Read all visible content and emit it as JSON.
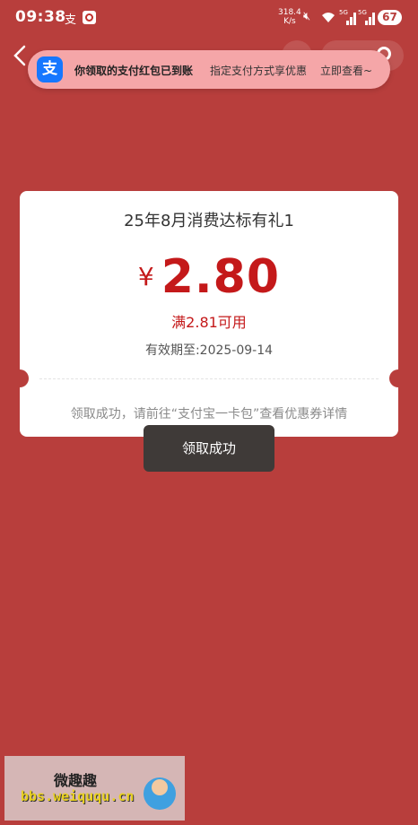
{
  "status_bar": {
    "time": "09:38",
    "net_speed_value": "318.4",
    "net_speed_unit": "K/s",
    "signal1_label": "5G",
    "signal2_label": "5G",
    "battery": "67"
  },
  "notification": {
    "icon_text": "支",
    "title": "你领取的支付红包已到账",
    "subtitle": "指定支付方式享优惠",
    "action": "立即查看~"
  },
  "coupon": {
    "title": "25年8月消费达标有礼1",
    "currency": "¥",
    "amount": "2.80",
    "condition": "满2.81可用",
    "validity": "有效期至:2025-09-14",
    "tip": "领取成功，请前往“支付宝一卡包”查看优惠券详情"
  },
  "toast": {
    "text": "领取成功"
  },
  "watermark": {
    "title": "微趣趣",
    "url": "bbs.weiququ.cn"
  },
  "colors": {
    "background": "#b83e3c",
    "accent_red": "#c4191a",
    "alipay_blue": "#1677ff"
  }
}
